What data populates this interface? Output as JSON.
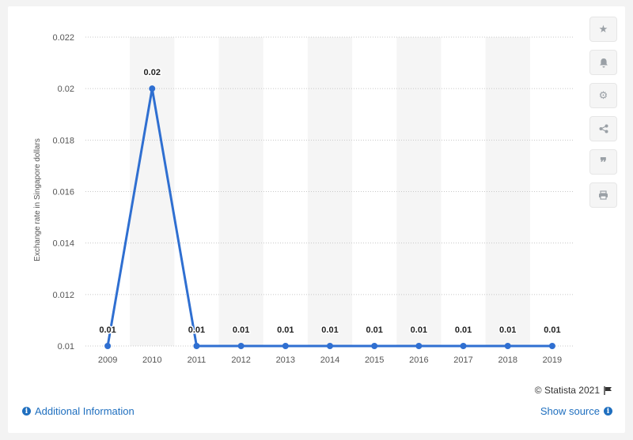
{
  "chart_data": {
    "type": "line",
    "title": "",
    "xlabel": "",
    "ylabel": "Exchange rate in Singapore dollars",
    "categories": [
      "2009",
      "2010",
      "2011",
      "2012",
      "2013",
      "2014",
      "2015",
      "2016",
      "2017",
      "2018",
      "2019"
    ],
    "series": [
      {
        "values": [
          0.01,
          0.02,
          0.01,
          0.01,
          0.01,
          0.01,
          0.01,
          0.01,
          0.01,
          0.01,
          0.01
        ],
        "labels": [
          "0.01",
          "0.02",
          "0.01",
          "0.01",
          "0.01",
          "0.01",
          "0.01",
          "0.01",
          "0.01",
          "0.01",
          "0.01"
        ],
        "color": "#2f6fd1"
      }
    ],
    "ylim": [
      0.01,
      0.022
    ],
    "yticks": [
      "0.01",
      "0.012",
      "0.014",
      "0.016",
      "0.018",
      "0.02",
      "0.022"
    ],
    "grid": true,
    "legend": "none"
  },
  "toolbar": {
    "icons": [
      "star-icon",
      "bell-icon",
      "gear-icon",
      "share-icon",
      "quote-icon",
      "print-icon"
    ]
  },
  "footer": {
    "additional_info": "Additional Information",
    "show_source": "Show source",
    "credit": "© Statista 2021"
  }
}
